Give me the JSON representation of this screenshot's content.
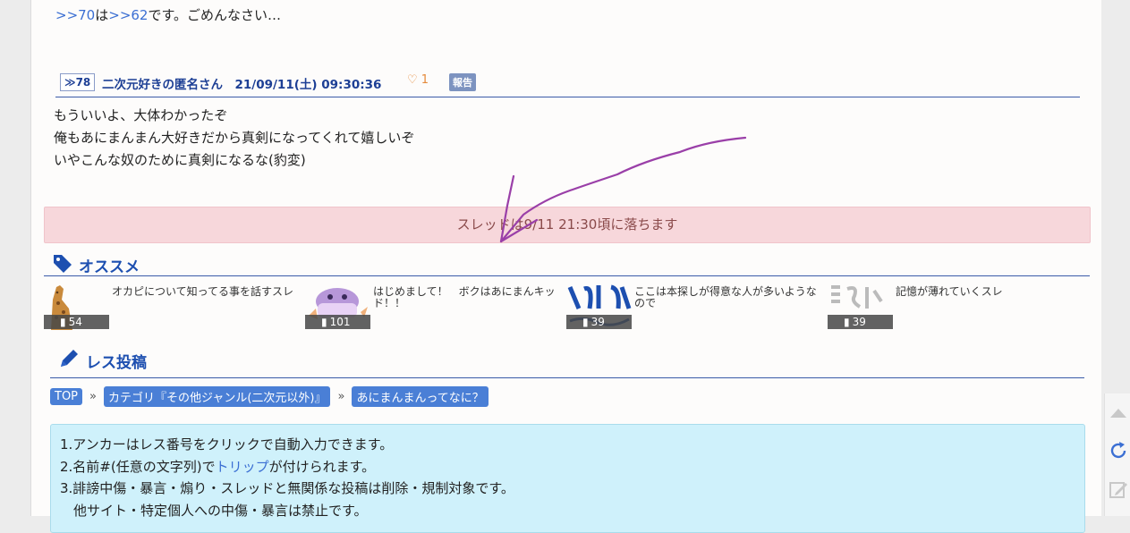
{
  "reply": {
    "anchor_a": ">>70",
    "mid": "は",
    "anchor_b": ">>62",
    "rest": "です。ごめんなさい…"
  },
  "post": {
    "number": "≫78",
    "meta": "二次元好きの匿名さん　21/09/11(土) 09:30:36",
    "likes": "1",
    "report": "報告",
    "lines": [
      "もういいよ、大体わかったぞ",
      "俺もあにまんまん大好きだから真剣になってくれて嬉しいぞ",
      "いやこんな奴のために真剣になるな(豹変)"
    ]
  },
  "notice": "スレッドは9/11 21:30頃に落ちます",
  "osusume": {
    "title": "オススメ",
    "items": [
      {
        "title": "オカピについて知ってる事を話すスレ",
        "count": "54"
      },
      {
        "title": "はじめまして！　ボクはあにまんキッド！！",
        "count": "101"
      },
      {
        "title": "ここは本探しが得意な人が多いようなので",
        "count": "39"
      },
      {
        "title": "記憶が薄れていくスレ",
        "count": "39"
      }
    ]
  },
  "res_post": {
    "title": "レス投稿"
  },
  "breadcrumb": {
    "items": [
      "TOP",
      "カテゴリ『その他ジャンル(二次元以外)』",
      "あにまんまんってなに？"
    ],
    "sep": "»"
  },
  "rules": {
    "line1": "1.アンカーはレス番号をクリックで自動入力できます。",
    "line2_pre": "2.名前#(任意の文字列)で",
    "line2_link": "トリップ",
    "line2_post": "が付けられます。",
    "line3": "3.誹謗中傷・暴言・煽り・スレッドと無関係な投稿は削除・規制対象です。",
    "line4": "　他サイト・特定個人への中傷・暴言は禁止です。"
  },
  "colors": {
    "accent": "#1d4fb0",
    "notice_bg": "#f7d7db",
    "rules_bg": "#cff1fb",
    "annotation": "#9a3fa8"
  },
  "icons": [
    "tag-icon",
    "pencil-icon",
    "heart-icon",
    "comment-icon",
    "scroll-up-icon",
    "refresh-icon",
    "edit-icon"
  ]
}
